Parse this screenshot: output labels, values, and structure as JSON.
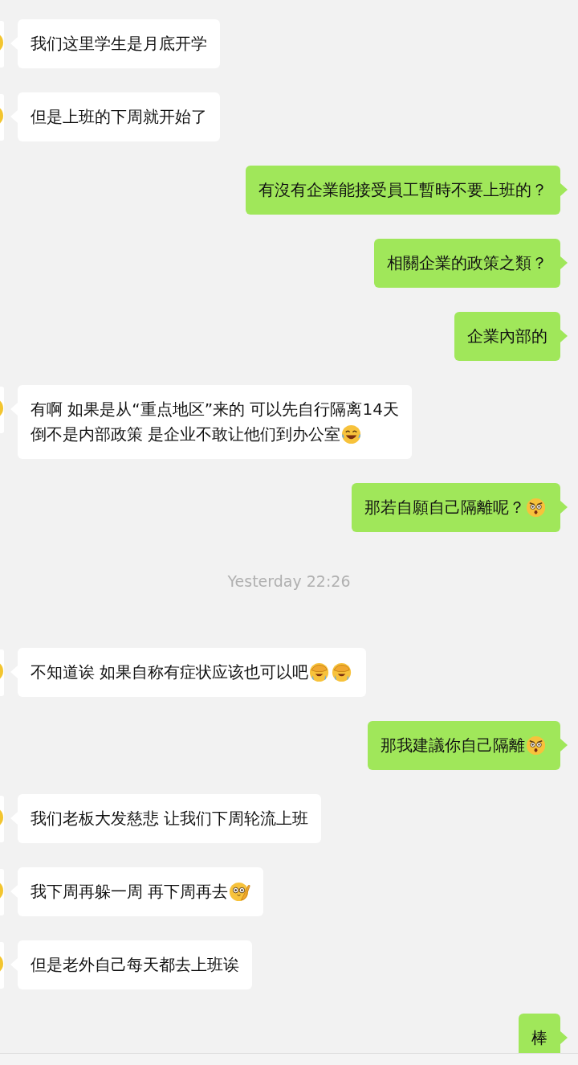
{
  "items": [
    {
      "kind": "received",
      "lines": [
        "我们这里学生是月底开学"
      ]
    },
    {
      "kind": "received",
      "lines": [
        "但是上班的下周就开始了"
      ]
    },
    {
      "kind": "sent",
      "lines": [
        "有沒有企業能接受員工暫時不要上班的？"
      ]
    },
    {
      "kind": "sent",
      "lines": [
        "相關企業的政策之類？"
      ]
    },
    {
      "kind": "sent",
      "lines": [
        "企業內部的"
      ]
    },
    {
      "kind": "received",
      "lines": [
        "有啊 如果是从“重点地区”来的 可以先自行隔离14天",
        "倒不是内部政策 是企业不敢让他们到办公室"
      ],
      "emojis": [
        {
          "kind": "laughing"
        }
      ]
    },
    {
      "kind": "sent",
      "lines": [
        "那若自願自己隔離呢？"
      ],
      "emojis": [
        {
          "kind": "shocked"
        }
      ]
    },
    {
      "kind": "time",
      "text": "Yesterday 22:26"
    },
    {
      "kind": "received",
      "lines": [
        "不知道诶 如果自称有症状应该也可以吧"
      ],
      "emojis": [
        {
          "kind": "facepalm"
        },
        {
          "kind": "facepalm"
        }
      ]
    },
    {
      "kind": "sent",
      "lines": [
        "那我建議你自己隔離"
      ],
      "emojis": [
        {
          "kind": "shocked"
        }
      ]
    },
    {
      "kind": "received",
      "lines": [
        "我们老板大发慈悲 让我们下周轮流上班"
      ]
    },
    {
      "kind": "received",
      "lines": [
        "我下周再躲一周 再下周再去"
      ],
      "emojis": [
        {
          "kind": "peeking"
        }
      ]
    },
    {
      "kind": "received",
      "lines": [
        "但是老外自己每天都去上班诶"
      ]
    },
    {
      "kind": "sent",
      "lines": [
        "棒"
      ]
    }
  ]
}
